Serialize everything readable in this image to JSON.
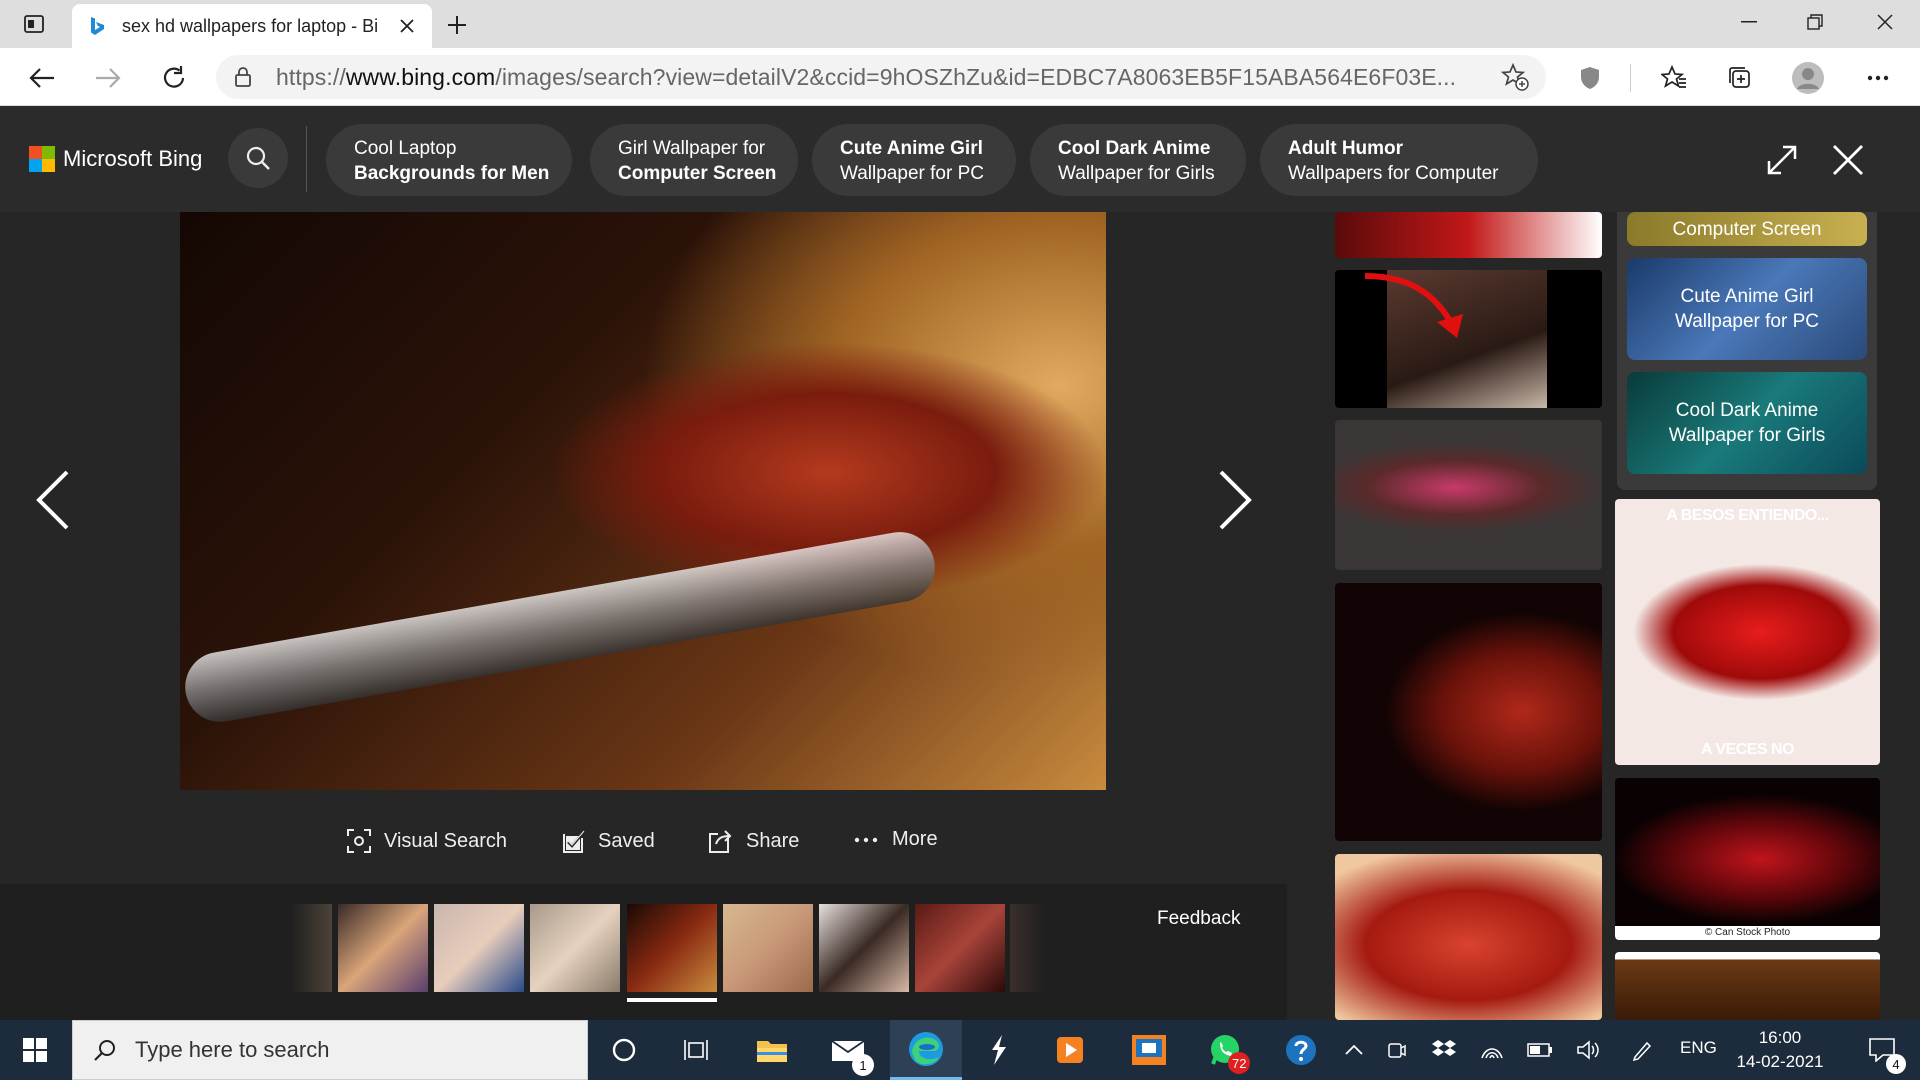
{
  "browser": {
    "tab_title": "sex hd wallpapers for laptop - Bi",
    "url_prefix": "https://",
    "url_host": "www.bing.com",
    "url_path": "/images/search?view=detailV2&ccid=9hOSZhZu&id=EDBC7A8063EB5F15ABA564E6F03E..."
  },
  "bing": {
    "brand": "Microsoft Bing",
    "chips": [
      {
        "line1": "Cool Laptop",
        "line2": "Backgrounds for Men"
      },
      {
        "line1": "Girl Wallpaper for",
        "line2": "Computer Screen"
      },
      {
        "line1": "Cute Anime Girl",
        "line2": "Wallpaper for PC"
      },
      {
        "line1": "Cool Dark Anime",
        "line2": "Wallpaper for Girls"
      },
      {
        "line1": "Adult Humor",
        "line2": "Wallpapers for Computer"
      }
    ],
    "logo_colors": [
      "#f25022",
      "#7fba00",
      "#00a4ef",
      "#ffb900"
    ]
  },
  "viewer": {
    "actions": {
      "visual_search": "Visual Search",
      "saved": "Saved",
      "share": "Share",
      "more": "More"
    },
    "feedback": "Feedback",
    "thumbnail_count": 8,
    "active_thumbnail": 4
  },
  "right_panel": {
    "partial_card": "Computer Screen",
    "card_anime_girl": {
      "line1": "Cute Anime Girl",
      "line2": "Wallpaper for PC"
    },
    "card_dark_anime": {
      "line1": "Cool Dark Anime",
      "line2": "Wallpaper for Girls"
    },
    "meme_top": "A BESOS ENTIENDO...",
    "meme_bottom": "A VECES NO",
    "credit": "© Can Stock Photo"
  },
  "taskbar": {
    "search_placeholder": "Type here to search",
    "mail_badge": "1",
    "whatsapp_badge": "72",
    "language": "ENG",
    "time": "16:00",
    "date": "14-02-2021",
    "notification_count": "4"
  },
  "colors": {
    "bing_bg": "#2b2b2b",
    "chip_bg": "#3a3a3a",
    "taskbar_bg": "#1c2c3c",
    "accent": "#0078d4"
  }
}
